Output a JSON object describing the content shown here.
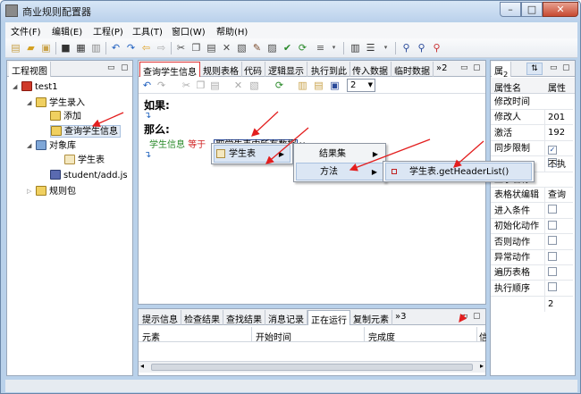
{
  "window": {
    "title": "商业规则配置器",
    "min": "–",
    "max": "□",
    "close": "✕"
  },
  "menu": [
    "文件(F)",
    "编辑(E)",
    "工程(P)",
    "工具(T)",
    "窗口(W)",
    "帮助(H)"
  ],
  "left_panel": {
    "tab": "工程视图",
    "tree": {
      "root": "test1",
      "n1": "学生录入",
      "n1a": "添加",
      "n1b": "查询学生信息",
      "n2": "对象库",
      "n2a": "学生表",
      "n3": "student/add.js",
      "n4": "规则包"
    }
  },
  "editor": {
    "tabs": [
      "查询学生信息",
      "规则表格",
      "代码",
      "逻辑显示",
      "执行到此",
      "传入数据",
      "临时数据"
    ],
    "tab_overflow": "»2",
    "selector_value": "2",
    "if_label": "如果:",
    "then_label": "那么:",
    "stmt_var": "学生信息",
    "stmt_op": "等于",
    "stmt_expr": "取学生表中所有数据"
  },
  "bottom_panel": {
    "tabs": [
      "提示信息",
      "检查结果",
      "查找结果",
      "消息记录",
      "正在运行",
      "复制元素"
    ],
    "tab_overflow": "»3",
    "columns": [
      "元素",
      "开始时间",
      "完成度",
      "信"
    ]
  },
  "props_panel": {
    "tab": "属",
    "tab_num": "2",
    "header_name": "属性名",
    "header_val": "属性",
    "rows": [
      {
        "name": "修改时间",
        "val": "201"
      },
      {
        "name": "修改人",
        "val": "192"
      },
      {
        "name": "激活",
        "checked": true
      },
      {
        "name": "同步限制",
        "checked": false
      },
      {
        "name": "",
        "val": "不执"
      },
      {
        "name": "显示名称",
        "val": "查询"
      },
      {
        "name": "表格状编辑",
        "checked": false
      },
      {
        "name": "进入条件",
        "checked": false
      },
      {
        "name": "初始化动作",
        "checked": false
      },
      {
        "name": "否则动作",
        "checked": false
      },
      {
        "name": "异常动作",
        "checked": false
      },
      {
        "name": "遍历表格",
        "checked": false
      },
      {
        "name": "执行顺序",
        "val": "2"
      }
    ]
  },
  "context_menu": {
    "item1": "学生表",
    "sub1_item1": "结果集",
    "sub1_item2": "方法",
    "sub2_item1": "学生表.getHeaderList()"
  },
  "colors": {
    "arrow": "#e31e1e",
    "tab_highlight": "#e23838"
  }
}
